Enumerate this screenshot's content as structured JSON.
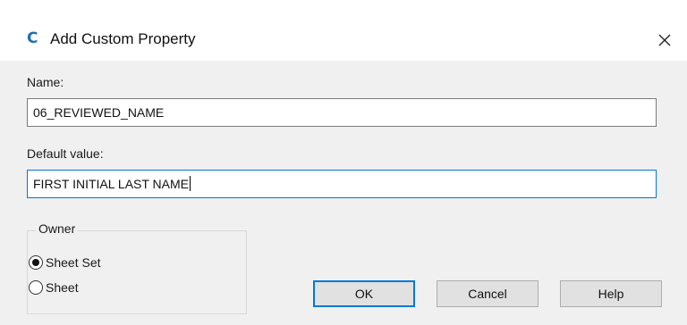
{
  "window": {
    "title": "Add Custom Property",
    "app_icon_glyph": "C",
    "close_glyph": "close-icon"
  },
  "form": {
    "name_label": "Name:",
    "name_value": "06_REVIEWED_NAME",
    "default_label": "Default value:",
    "default_value": "FIRST INITIAL LAST NAME"
  },
  "owner": {
    "legend": "Owner",
    "options": [
      {
        "label": "Sheet Set",
        "selected": true
      },
      {
        "label": "Sheet",
        "selected": false
      }
    ]
  },
  "buttons": {
    "ok": "OK",
    "cancel": "Cancel",
    "help": "Help"
  },
  "colors": {
    "accent": "#0078d7",
    "app_icon": "#1f6fb2",
    "dialog_bg": "#f0f0f0"
  }
}
